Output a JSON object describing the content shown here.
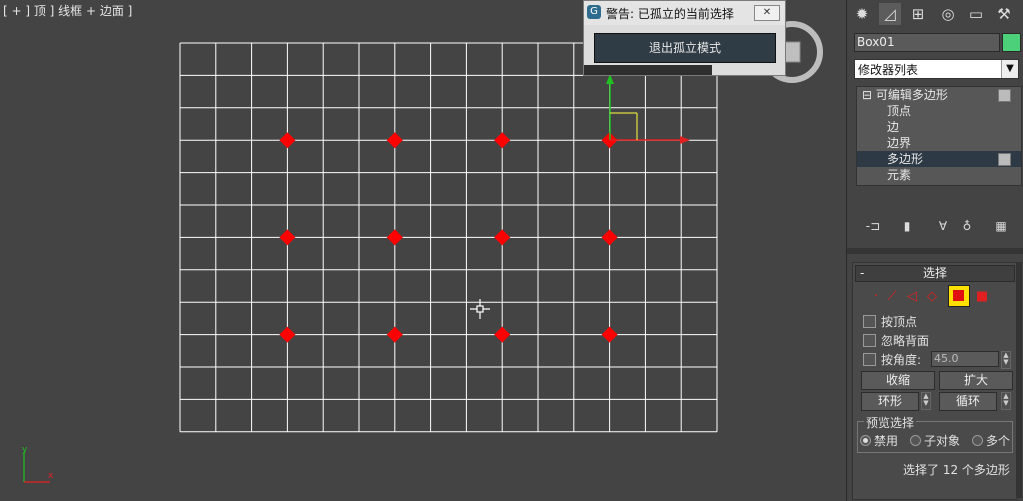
{
  "viewport": {
    "label": "[ + ] 顶 ] 线框 + 边面 ]",
    "grid": {
      "cols": 15,
      "rows": 12
    },
    "selected_polygon_markers": {
      "rows": 3,
      "cols": 4
    },
    "colors": {
      "background": "#444444",
      "grid": "#ffffff",
      "marker": "#ff0000",
      "axis_x": "#e02020",
      "axis_y": "#20c020"
    }
  },
  "isolate_dialog": {
    "title": "警告: 已孤立的当前选择",
    "close_icon": "close-icon",
    "exit_button": "退出孤立模式"
  },
  "panel": {
    "tabs": [
      "create-icon",
      "modify-icon",
      "hierarchy-icon",
      "motion-icon",
      "display-icon",
      "utilities-icon"
    ],
    "object_name": "Box01",
    "object_color": "#4cd17a",
    "modifier_list": "修改器列表",
    "stack": [
      {
        "label": "可编辑多边形",
        "level": 0,
        "prefix": "⊟"
      },
      {
        "label": "顶点",
        "level": 1
      },
      {
        "label": "边",
        "level": 1
      },
      {
        "label": "边界",
        "level": 1
      },
      {
        "label": "多边形",
        "level": 1
      },
      {
        "label": "元素",
        "level": 1
      }
    ],
    "selection_rollout": {
      "minus": "-",
      "title": "选择",
      "by_vertex": "按顶点",
      "ignore_backfacing": "忽略背面",
      "by_angle": "按角度:",
      "angle_value": "45.0",
      "shrink": "收缩",
      "grow": "扩大",
      "ring": "环形",
      "loop": "循环",
      "preview_title": "预览选择",
      "preview_options": [
        "禁用",
        "子对象",
        "多个"
      ],
      "status": "选择了 12 个多边形"
    }
  }
}
